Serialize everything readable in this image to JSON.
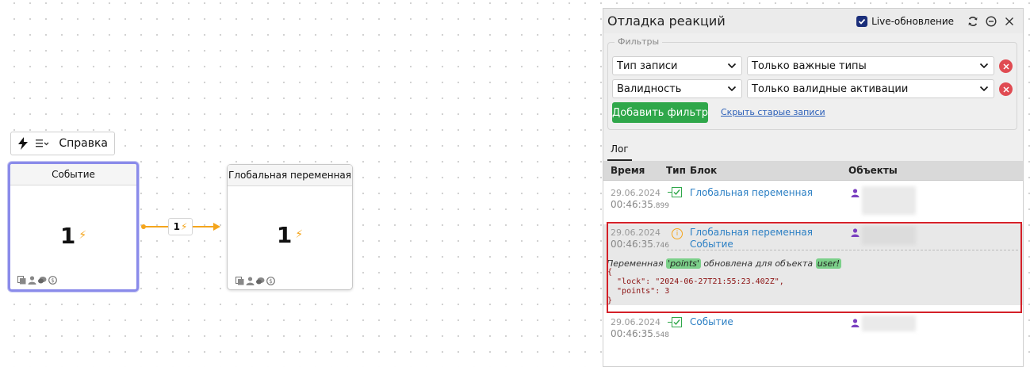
{
  "canvas": {
    "toolbar": {
      "help_label": "Справка"
    },
    "nodes": [
      {
        "title": "Событие",
        "value": "1"
      },
      {
        "title": "Глобальная переменная",
        "value": "1"
      }
    ],
    "edge": {
      "label_value": "1"
    },
    "colors": {
      "accent": "#f4a51c",
      "selection": "#8a8bea"
    }
  },
  "panel": {
    "title": "Отладка реакций",
    "live_label": "Live-обновление",
    "live_checked": true,
    "filters": {
      "legend": "Фильтры",
      "rows": [
        {
          "field": "Тип записи",
          "value": "Только важные типы"
        },
        {
          "field": "Валидность",
          "value": "Только валидные активации"
        }
      ],
      "add_label": "Добавить фильтр",
      "hide_old_label": "Скрыть старые записи"
    },
    "tabs": [
      {
        "label": "Лог",
        "active": true
      }
    ],
    "table": {
      "headers": {
        "time": "Время",
        "type": "Тип",
        "block": "Блок",
        "objects": "Объекты"
      },
      "rows": [
        {
          "date": "29.06.2024",
          "time": "00:46:35",
          "ms": ".899",
          "type": "valid",
          "blocks": [
            "Глобальная переменная"
          ]
        },
        {
          "date": "29.06.2024",
          "time": "00:46:35",
          "ms": ".746",
          "type": "info",
          "blocks": [
            "Глобальная переменная",
            "Событие"
          ],
          "message": {
            "prefix": "Переменная ",
            "var": "'points'",
            "middle": " обновлена для объекта ",
            "obj": "user!"
          },
          "code": "{\n  \"lock\": \"2024-06-27T21:55:23.402Z\",\n  \"points\": 3\n}"
        },
        {
          "date": "29.06.2024",
          "time": "00:46:35",
          "ms": ".548",
          "type": "valid",
          "blocks": [
            "Событие"
          ]
        }
      ]
    },
    "colors": {
      "add_button": "#2fa74a",
      "highlight": "#d42028",
      "link": "#2b7fc4",
      "delete": "#e04b52"
    }
  }
}
